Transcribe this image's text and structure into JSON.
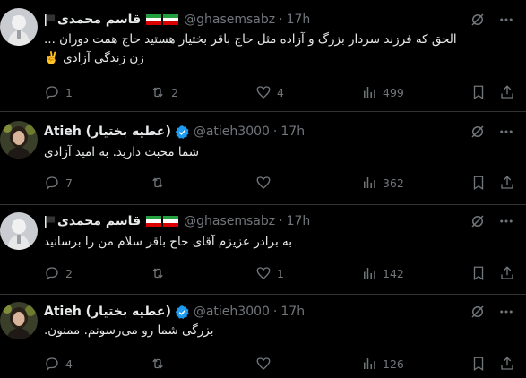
{
  "colors": {
    "background": "#000000",
    "text": "#e7e9ea",
    "muted": "#71767b",
    "verified": "#1d9bf0",
    "divider": "#2f3336"
  },
  "tweets": [
    {
      "display_name": "قاسم محمدی",
      "handle": "@ghasemsabz",
      "time": "17h",
      "verified": false,
      "icons": [
        "black-flag-icon",
        "iran-flag-icon",
        "iran-flag-icon"
      ],
      "text_lines": [
        "الحق که فرزند سردار بزرگ و آزاده مثل حاج باقر بختیار هستید حاج همت دوران ...",
        "زن زندگی آزادی ✌️"
      ],
      "replies": "1",
      "reposts": "2",
      "likes": "4",
      "views": "499"
    },
    {
      "display_name": "Atieh (عطیه بختیار)",
      "handle": "@atieh3000",
      "time": "17h",
      "verified": true,
      "text_lines": [
        "شما محبت دارید. به امید آزادی"
      ],
      "replies": "7",
      "reposts": "",
      "likes": "",
      "views": "362"
    },
    {
      "display_name": "قاسم محمدی",
      "handle": "@ghasemsabz",
      "time": "17h",
      "verified": false,
      "icons": [
        "black-flag-icon",
        "iran-flag-icon",
        "iran-flag-icon"
      ],
      "text_lines": [
        "به برادر عزیزم آقای حاج باقر سلام من را برسانید"
      ],
      "replies": "2",
      "reposts": "",
      "likes": "1",
      "views": "142"
    },
    {
      "display_name": "Atieh (عطیه بختیار)",
      "handle": "@atieh3000",
      "time": "17h",
      "verified": true,
      "text_lines": [
        "بزرگی شما رو می‌رسونم. ممنون."
      ],
      "replies": "4",
      "reposts": "",
      "likes": "",
      "views": "126"
    }
  ],
  "separator": "·"
}
